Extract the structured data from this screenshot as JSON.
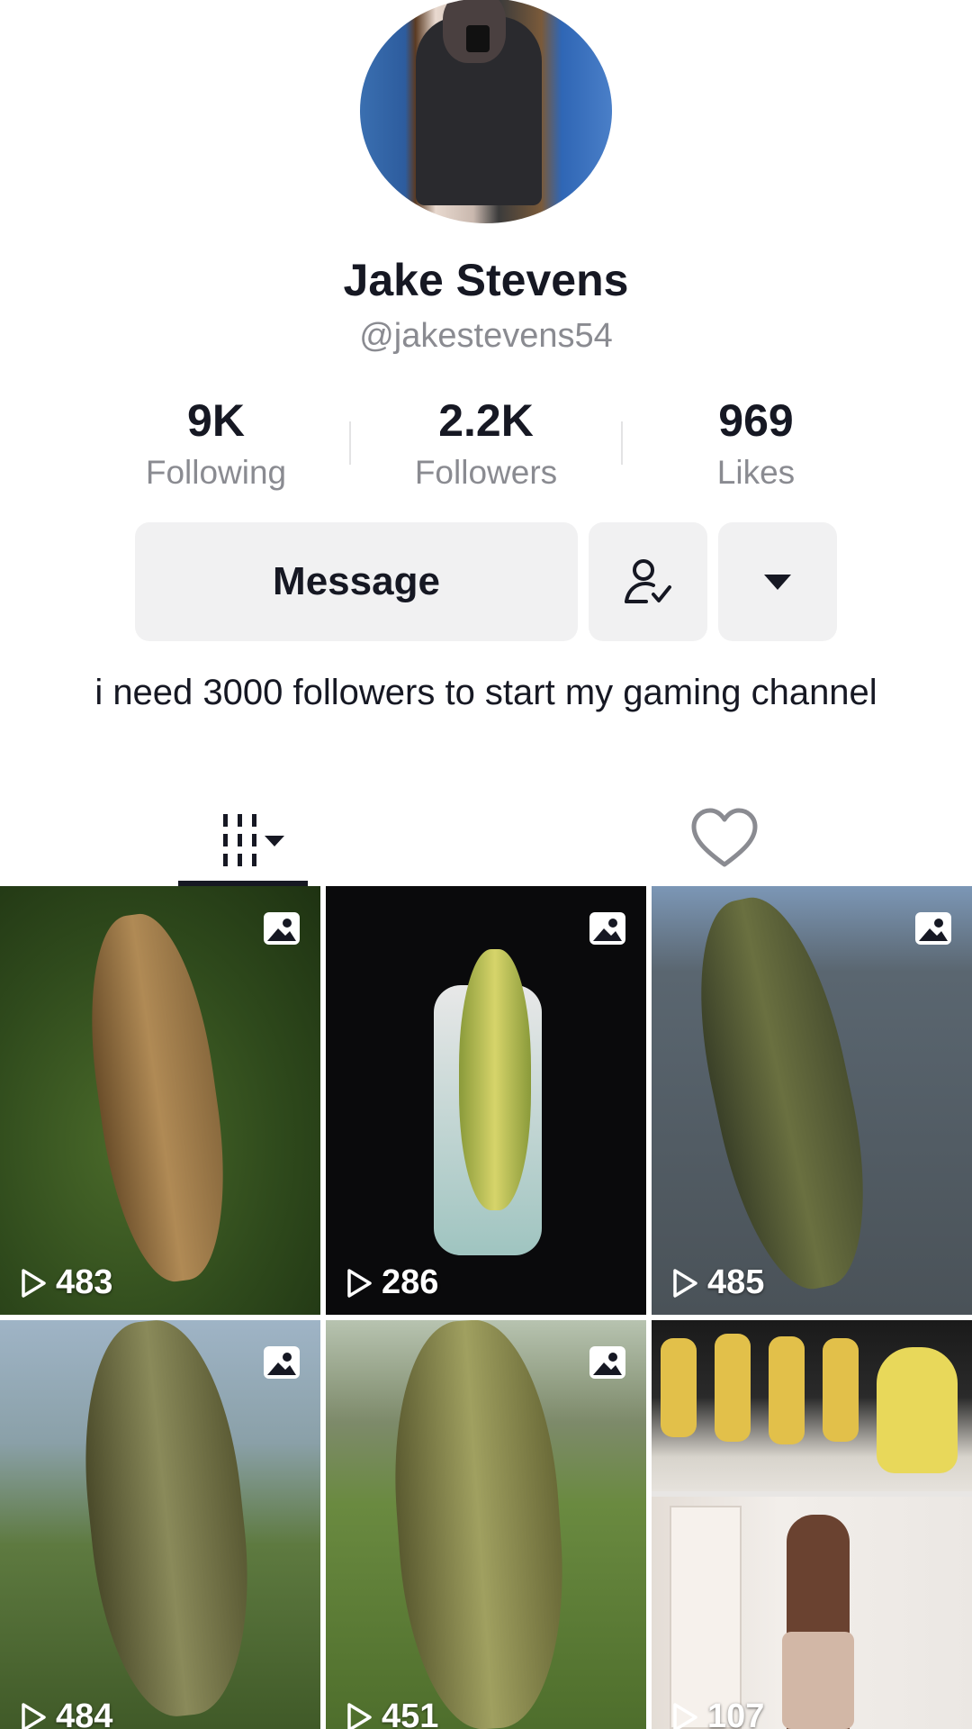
{
  "profile": {
    "display_name": "Jake Stevens",
    "username": "@jakestevens54",
    "bio": "i need 3000 followers to start my gaming channel"
  },
  "stats": [
    {
      "value": "9K",
      "label": "Following"
    },
    {
      "value": "2.2K",
      "label": "Followers"
    },
    {
      "value": "969",
      "label": "Likes"
    }
  ],
  "actions": {
    "message_label": "Message",
    "following_icon": "person-check-icon",
    "more_icon": "caret-down-icon"
  },
  "tabs": [
    {
      "name": "videos",
      "icon": "grid-videos-icon",
      "selected": true
    },
    {
      "name": "liked",
      "icon": "heart-outline-icon",
      "selected": false
    }
  ],
  "videos": [
    {
      "views": "483",
      "photo": true
    },
    {
      "views": "286",
      "photo": true
    },
    {
      "views": "485",
      "photo": true
    },
    {
      "views": "484",
      "photo": true
    },
    {
      "views": "451",
      "photo": true
    },
    {
      "views": "107",
      "photo": false
    }
  ]
}
